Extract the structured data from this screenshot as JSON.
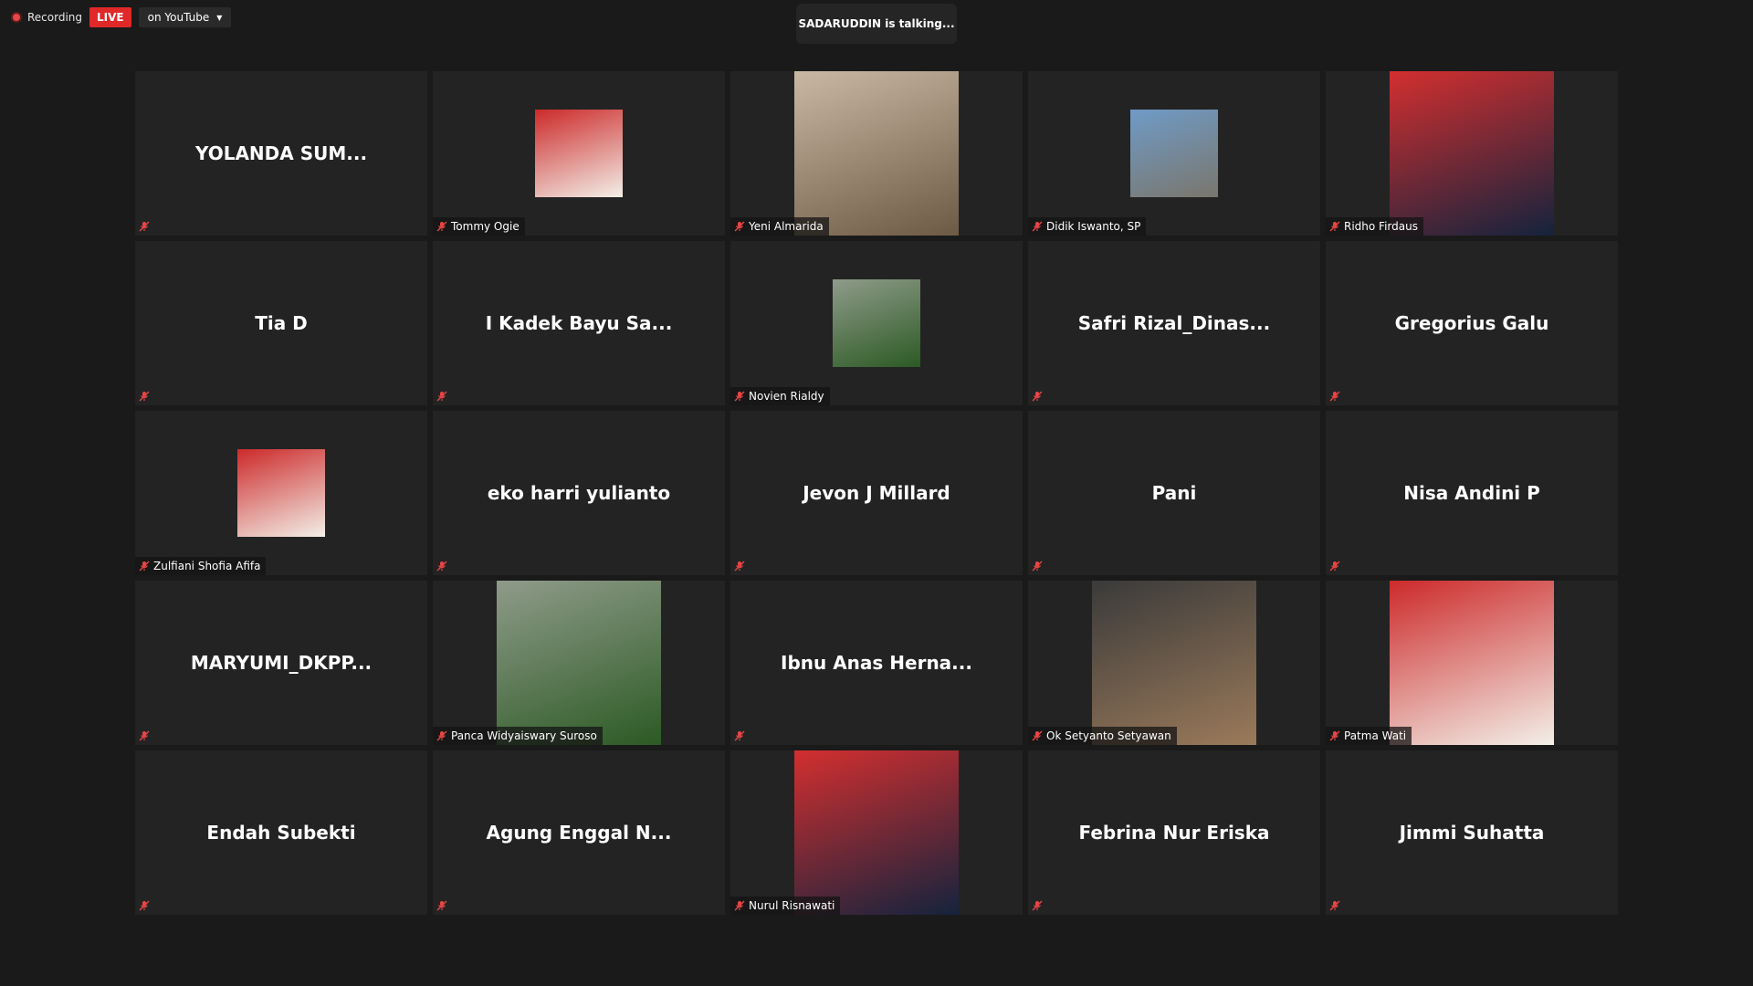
{
  "topbar": {
    "recording": "Recording",
    "live": "LIVE",
    "on_youtube": "on YouTube"
  },
  "talking": "SADARUDDIN is talking...",
  "tiles": [
    {
      "display": "YOLANDA  SUM...",
      "label": "",
      "photo": null
    },
    {
      "display": "",
      "label": "Tommy Ogie",
      "photo": "small"
    },
    {
      "display": "",
      "label": "Yeni Almarida",
      "photo": "large"
    },
    {
      "display": "",
      "label": "Didik Iswanto, SP",
      "photo": "small"
    },
    {
      "display": "",
      "label": "Ridho Firdaus",
      "photo": "large"
    },
    {
      "display": "Tia D",
      "label": "",
      "photo": null
    },
    {
      "display": "I Kadek Bayu Sa...",
      "label": "",
      "photo": null
    },
    {
      "display": "",
      "label": "Novien Rialdy",
      "photo": "small"
    },
    {
      "display": "Safri  Rizal_Dinas...",
      "label": "",
      "photo": null
    },
    {
      "display": "Gregorius Galu",
      "label": "",
      "photo": null
    },
    {
      "display": "",
      "label": "Zulfiani Shofia Afifa",
      "photo": "small"
    },
    {
      "display": "eko harri yulianto",
      "label": "",
      "photo": null
    },
    {
      "display": "Jevon J Millard",
      "label": "",
      "photo": null
    },
    {
      "display": "Pani",
      "label": "",
      "photo": null
    },
    {
      "display": "Nisa Andini P",
      "label": "",
      "photo": null
    },
    {
      "display": "MARYUMI_DKPP...",
      "label": "",
      "photo": null
    },
    {
      "display": "",
      "label": "Panca Widyaiswary Suroso",
      "photo": "large"
    },
    {
      "display": "Ibnu  Anas  Herna...",
      "label": "",
      "photo": null
    },
    {
      "display": "",
      "label": "Ok Setyanto Setyawan",
      "photo": "large"
    },
    {
      "display": "",
      "label": "Patma Wati",
      "photo": "large"
    },
    {
      "display": "Endah Subekti",
      "label": "",
      "photo": null
    },
    {
      "display": "Agung  Enggal  N...",
      "label": "",
      "photo": null
    },
    {
      "display": "",
      "label": "Nurul Risnawati",
      "photo": "large"
    },
    {
      "display": "Febrina Nur Eriska",
      "label": "",
      "photo": null
    },
    {
      "display": "Jimmi Suhatta",
      "label": "",
      "photo": null
    }
  ],
  "colors": {
    "tile_bg": "#232323",
    "live_red": "#e02828",
    "mic_muted": "#e84545"
  }
}
